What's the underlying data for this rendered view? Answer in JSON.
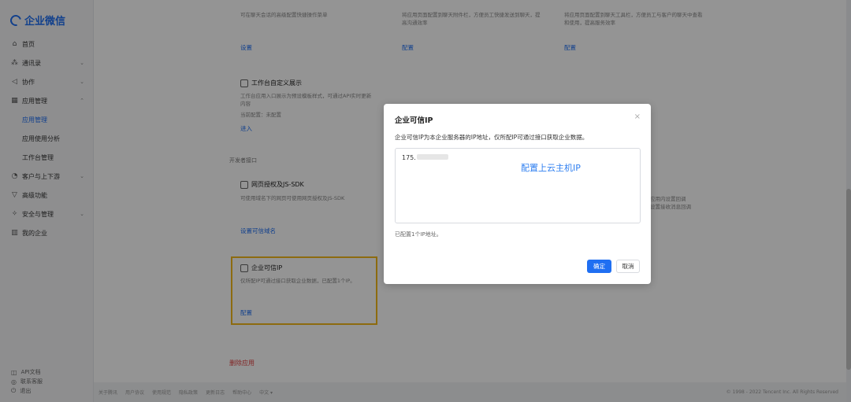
{
  "app": {
    "logo_text": "企业微信"
  },
  "sidebar": {
    "items": [
      {
        "label": "首页",
        "icon": "home-icon",
        "glyph": "⌂"
      },
      {
        "label": "通讯录",
        "icon": "contacts-icon",
        "glyph": "⁂",
        "chevron": "⌄"
      },
      {
        "label": "协作",
        "icon": "collaboration-icon",
        "glyph": "◁",
        "chevron": "⌄"
      },
      {
        "label": "应用管理",
        "icon": "apps-icon",
        "glyph": "▦",
        "chevron": "⌃"
      }
    ],
    "subitems": [
      {
        "label": "应用管理",
        "active": true
      },
      {
        "label": "应用使用分析"
      },
      {
        "label": "工作台管理"
      }
    ],
    "items2": [
      {
        "label": "客户与上下游",
        "icon": "customer-icon",
        "glyph": "◔",
        "chevron": "⌄"
      },
      {
        "label": "高级功能",
        "icon": "advanced-icon",
        "glyph": "▽"
      },
      {
        "label": "安全与管理",
        "icon": "security-icon",
        "glyph": "✧",
        "chevron": "⌄"
      },
      {
        "label": "我的企业",
        "icon": "company-icon",
        "glyph": "▥"
      }
    ],
    "bottom": [
      {
        "label": "API文档",
        "icon": "api-doc-icon",
        "glyph": "◫"
      },
      {
        "label": "联系客服",
        "icon": "support-icon",
        "glyph": "◎"
      },
      {
        "label": "退出",
        "icon": "logout-icon",
        "glyph": "⏻"
      }
    ]
  },
  "main": {
    "top_cards": [
      {
        "text": "可在聊天会话的高级配置快捷操作菜单",
        "link": "设置"
      },
      {
        "text": "将应用页面配置到聊天附件栏，方便员工快捷发送到聊天，提高沟通效率",
        "link": "配置"
      },
      {
        "text": "将应用页面配置到聊天工具栏，方便员工与客户的聊天中查看和使用，提高服务效率",
        "link": "配置"
      }
    ],
    "workbench_card": {
      "title": "工作台自定义展示",
      "desc": "工作台应用入口展示为预设模板样式，可通过API实时更新内容",
      "status": "当前配置：未配置",
      "link": "进入"
    },
    "dev_section": "开发者接口",
    "oauth_card": {
      "title": "网页授权及JS-SDK",
      "desc": "可使用域名下的网页可使用网页授权及JS-SDK",
      "link": "设置可信域名"
    },
    "right_partial": {
      "line1": "应用内设置回调",
      "line2": "设置接收消息回调"
    },
    "trusted_ip_card": {
      "title": "企业可信IP",
      "desc": "仅所配IP可通过接口获取企业数据，已配置1个IP。",
      "link": "配置"
    },
    "delete_app": "删除应用"
  },
  "footer": {
    "links": [
      "关于腾讯",
      "用户协议",
      "使用规范",
      "隐私政策",
      "更新日志",
      "帮助中心",
      "中文 ▾"
    ],
    "copyright": "© 1998 - 2022 Tencent Inc. All Rights Reserved"
  },
  "modal": {
    "title": "企业可信IP",
    "close": "×",
    "desc": "企业可信IP为本企业服务器的IP地址，仅所配IP可通过接口获取企业数据。",
    "ip_value": "175.",
    "annotation": "配置上云主机IP",
    "hint": "已配置1个IP地址。",
    "confirm": "确定",
    "cancel": "取消"
  }
}
